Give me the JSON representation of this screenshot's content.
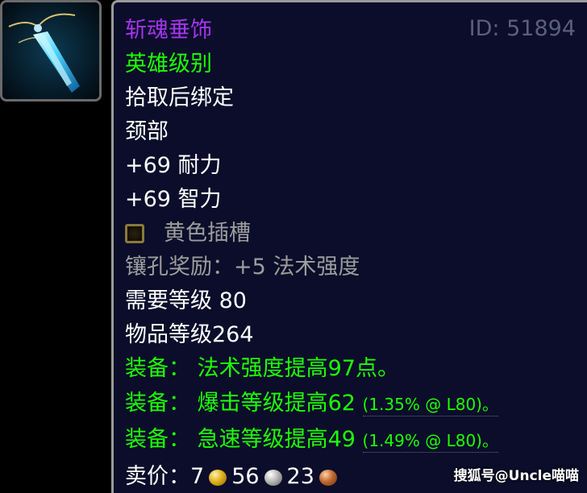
{
  "item": {
    "name": "斩魂垂饰",
    "id_label": "ID: 51894",
    "difficulty": "英雄级别",
    "binding": "拾取后绑定",
    "slot": "颈部",
    "stats": [
      "+69 耐力",
      "+69 智力"
    ],
    "socket": {
      "icon": "yellow-socket-icon",
      "label": "黄色插槽"
    },
    "socket_bonus": "镶孔奖励：+5 法术强度",
    "required_level": "需要等级 80",
    "item_level": "物品等级264",
    "equip_effects": [
      {
        "text": "装备： 法术强度提高97点。",
        "detail": ""
      },
      {
        "text": "装备： 爆击等级提高62 ",
        "detail": "(1.35% @ L80)。"
      },
      {
        "text": "装备： 急速等级提高49 ",
        "detail": "(1.49% @ L80)。"
      }
    ],
    "sell_price": {
      "label": "卖价：",
      "gold": "7",
      "silver": "56",
      "copper": "23"
    }
  },
  "watermark": "搜狐号@Uncle喵喵",
  "colors": {
    "epic": "#a335ee",
    "uncommon_green": "#1eff00",
    "white": "#ffffff",
    "gray": "#9d9d9d",
    "tooltip_bg": "#0b0d2a"
  }
}
